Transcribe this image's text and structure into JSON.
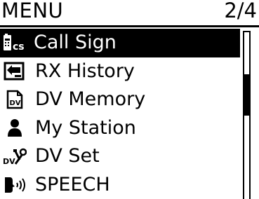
{
  "header": {
    "title": "MENU",
    "page_indicator": "2/4"
  },
  "menu": {
    "items": [
      {
        "label": "Call Sign",
        "icon": "call-sign-icon",
        "selected": true
      },
      {
        "label": "RX History",
        "icon": "rx-history-icon",
        "selected": false
      },
      {
        "label": "DV Memory",
        "icon": "dv-memory-icon",
        "selected": false
      },
      {
        "label": "My Station",
        "icon": "my-station-icon",
        "selected": false
      },
      {
        "label": "DV Set",
        "icon": "dv-set-icon",
        "selected": false
      },
      {
        "label": "SPEECH",
        "icon": "speech-icon",
        "selected": false
      }
    ]
  },
  "scrollbar": {
    "thumb_start_fraction": 0.25,
    "thumb_end_fraction": 0.5
  },
  "colors": {
    "foreground": "#000000",
    "background": "#ffffff"
  }
}
